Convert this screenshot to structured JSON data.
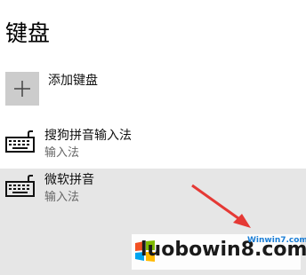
{
  "page": {
    "title": "键盘"
  },
  "add_keyboard": {
    "label": "添加键盘",
    "icon": "plus-icon"
  },
  "keyboards": [
    {
      "name": "搜狗拼音输入法",
      "subtitle": "输入法",
      "icon": "keyboard-icon"
    },
    {
      "name": "微软拼音",
      "subtitle": "输入法",
      "icon": "keyboard-icon"
    }
  ],
  "watermark": {
    "text": "luobowin8.com",
    "sub": "Winwin7.com",
    "logo_text": "W"
  },
  "colors": {
    "selected_bg": "#e6e6e6",
    "tile_bg": "#cccccc",
    "arrow": "#e53935"
  }
}
